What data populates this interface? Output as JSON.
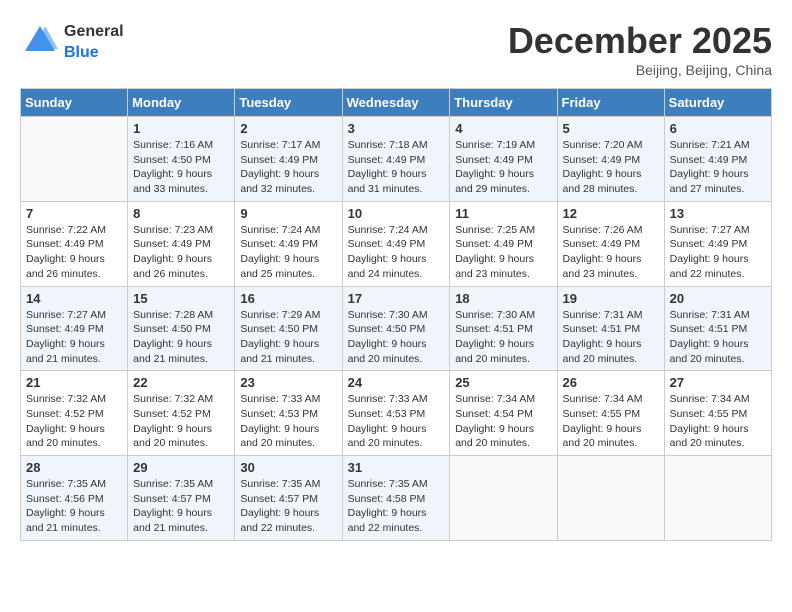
{
  "header": {
    "logo_general": "General",
    "logo_blue": "Blue",
    "month_title": "December 2025",
    "location": "Beijing, Beijing, China"
  },
  "days_of_week": [
    "Sunday",
    "Monday",
    "Tuesday",
    "Wednesday",
    "Thursday",
    "Friday",
    "Saturday"
  ],
  "weeks": [
    [
      {
        "day": "",
        "info": ""
      },
      {
        "day": "1",
        "info": "Sunrise: 7:16 AM\nSunset: 4:50 PM\nDaylight: 9 hours\nand 33 minutes."
      },
      {
        "day": "2",
        "info": "Sunrise: 7:17 AM\nSunset: 4:49 PM\nDaylight: 9 hours\nand 32 minutes."
      },
      {
        "day": "3",
        "info": "Sunrise: 7:18 AM\nSunset: 4:49 PM\nDaylight: 9 hours\nand 31 minutes."
      },
      {
        "day": "4",
        "info": "Sunrise: 7:19 AM\nSunset: 4:49 PM\nDaylight: 9 hours\nand 29 minutes."
      },
      {
        "day": "5",
        "info": "Sunrise: 7:20 AM\nSunset: 4:49 PM\nDaylight: 9 hours\nand 28 minutes."
      },
      {
        "day": "6",
        "info": "Sunrise: 7:21 AM\nSunset: 4:49 PM\nDaylight: 9 hours\nand 27 minutes."
      }
    ],
    [
      {
        "day": "7",
        "info": "Sunrise: 7:22 AM\nSunset: 4:49 PM\nDaylight: 9 hours\nand 26 minutes."
      },
      {
        "day": "8",
        "info": "Sunrise: 7:23 AM\nSunset: 4:49 PM\nDaylight: 9 hours\nand 26 minutes."
      },
      {
        "day": "9",
        "info": "Sunrise: 7:24 AM\nSunset: 4:49 PM\nDaylight: 9 hours\nand 25 minutes."
      },
      {
        "day": "10",
        "info": "Sunrise: 7:24 AM\nSunset: 4:49 PM\nDaylight: 9 hours\nand 24 minutes."
      },
      {
        "day": "11",
        "info": "Sunrise: 7:25 AM\nSunset: 4:49 PM\nDaylight: 9 hours\nand 23 minutes."
      },
      {
        "day": "12",
        "info": "Sunrise: 7:26 AM\nSunset: 4:49 PM\nDaylight: 9 hours\nand 23 minutes."
      },
      {
        "day": "13",
        "info": "Sunrise: 7:27 AM\nSunset: 4:49 PM\nDaylight: 9 hours\nand 22 minutes."
      }
    ],
    [
      {
        "day": "14",
        "info": "Sunrise: 7:27 AM\nSunset: 4:49 PM\nDaylight: 9 hours\nand 21 minutes."
      },
      {
        "day": "15",
        "info": "Sunrise: 7:28 AM\nSunset: 4:50 PM\nDaylight: 9 hours\nand 21 minutes."
      },
      {
        "day": "16",
        "info": "Sunrise: 7:29 AM\nSunset: 4:50 PM\nDaylight: 9 hours\nand 21 minutes."
      },
      {
        "day": "17",
        "info": "Sunrise: 7:30 AM\nSunset: 4:50 PM\nDaylight: 9 hours\nand 20 minutes."
      },
      {
        "day": "18",
        "info": "Sunrise: 7:30 AM\nSunset: 4:51 PM\nDaylight: 9 hours\nand 20 minutes."
      },
      {
        "day": "19",
        "info": "Sunrise: 7:31 AM\nSunset: 4:51 PM\nDaylight: 9 hours\nand 20 minutes."
      },
      {
        "day": "20",
        "info": "Sunrise: 7:31 AM\nSunset: 4:51 PM\nDaylight: 9 hours\nand 20 minutes."
      }
    ],
    [
      {
        "day": "21",
        "info": "Sunrise: 7:32 AM\nSunset: 4:52 PM\nDaylight: 9 hours\nand 20 minutes."
      },
      {
        "day": "22",
        "info": "Sunrise: 7:32 AM\nSunset: 4:52 PM\nDaylight: 9 hours\nand 20 minutes."
      },
      {
        "day": "23",
        "info": "Sunrise: 7:33 AM\nSunset: 4:53 PM\nDaylight: 9 hours\nand 20 minutes."
      },
      {
        "day": "24",
        "info": "Sunrise: 7:33 AM\nSunset: 4:53 PM\nDaylight: 9 hours\nand 20 minutes."
      },
      {
        "day": "25",
        "info": "Sunrise: 7:34 AM\nSunset: 4:54 PM\nDaylight: 9 hours\nand 20 minutes."
      },
      {
        "day": "26",
        "info": "Sunrise: 7:34 AM\nSunset: 4:55 PM\nDaylight: 9 hours\nand 20 minutes."
      },
      {
        "day": "27",
        "info": "Sunrise: 7:34 AM\nSunset: 4:55 PM\nDaylight: 9 hours\nand 20 minutes."
      }
    ],
    [
      {
        "day": "28",
        "info": "Sunrise: 7:35 AM\nSunset: 4:56 PM\nDaylight: 9 hours\nand 21 minutes."
      },
      {
        "day": "29",
        "info": "Sunrise: 7:35 AM\nSunset: 4:57 PM\nDaylight: 9 hours\nand 21 minutes."
      },
      {
        "day": "30",
        "info": "Sunrise: 7:35 AM\nSunset: 4:57 PM\nDaylight: 9 hours\nand 22 minutes."
      },
      {
        "day": "31",
        "info": "Sunrise: 7:35 AM\nSunset: 4:58 PM\nDaylight: 9 hours\nand 22 minutes."
      },
      {
        "day": "",
        "info": ""
      },
      {
        "day": "",
        "info": ""
      },
      {
        "day": "",
        "info": ""
      }
    ]
  ]
}
